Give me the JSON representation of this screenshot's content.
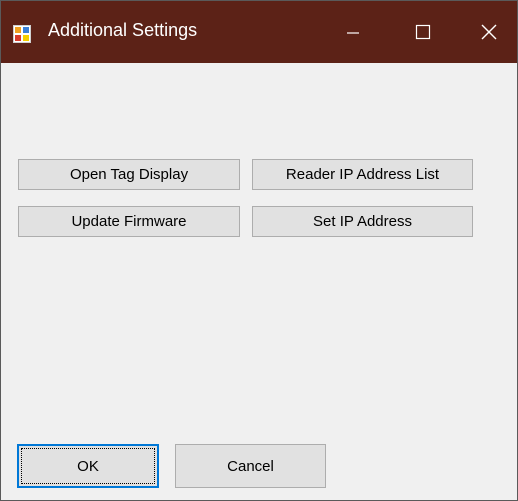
{
  "window": {
    "title": "Additional Settings",
    "app_icon": "winforms-app-icon",
    "controls": {
      "minimize_icon": "minimize-icon",
      "maximize_icon": "maximize-icon",
      "close_icon": "close-icon"
    }
  },
  "buttons": {
    "open_tag_display": "Open Tag Display",
    "reader_ip_address_list": "Reader IP Address List",
    "update_firmware": "Update Firmware",
    "set_ip_address": "Set IP Address",
    "ok": "OK",
    "cancel": "Cancel"
  },
  "colors": {
    "titlebar": "#5c2217",
    "title_text": "#ffffff",
    "window_bg": "#f0f0f0",
    "button_face": "#e1e1e1",
    "button_border": "#adadad",
    "default_button_border": "#0078d7"
  }
}
